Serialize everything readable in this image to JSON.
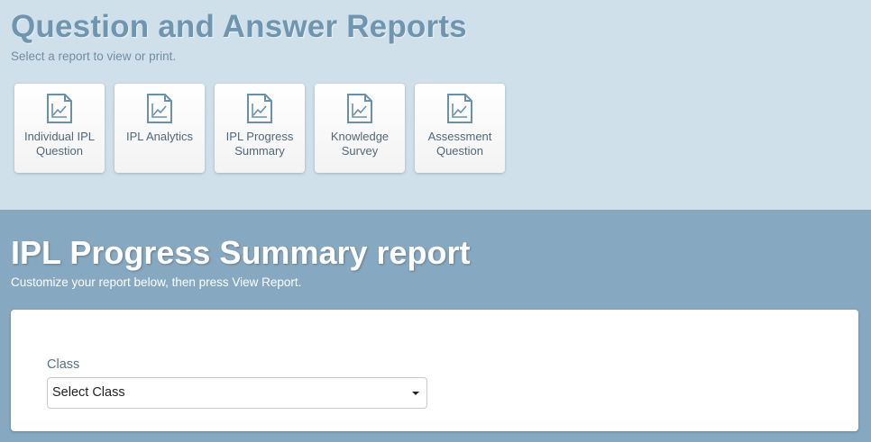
{
  "header": {
    "title": "Question and Answer Reports",
    "subtitle": "Select a report to view or print."
  },
  "reports": [
    {
      "label": "Individual IPL Question",
      "icon": "report-chart-icon"
    },
    {
      "label": "IPL Analytics",
      "icon": "report-chart-icon"
    },
    {
      "label": "IPL Progress Summary",
      "icon": "report-chart-icon"
    },
    {
      "label": "Knowledge Survey",
      "icon": "report-chart-icon"
    },
    {
      "label": "Assessment Question",
      "icon": "report-chart-icon"
    }
  ],
  "report": {
    "title": "IPL Progress Summary report",
    "subtitle": "Customize your report below, then press View Report.",
    "class_label": "Class",
    "class_value": "Select Class"
  },
  "colors": {
    "top_bg": "#d0e0ea",
    "bottom_bg": "#86a8c0",
    "title_blue": "#6f96b1",
    "icon_blue": "#6a91ab"
  }
}
